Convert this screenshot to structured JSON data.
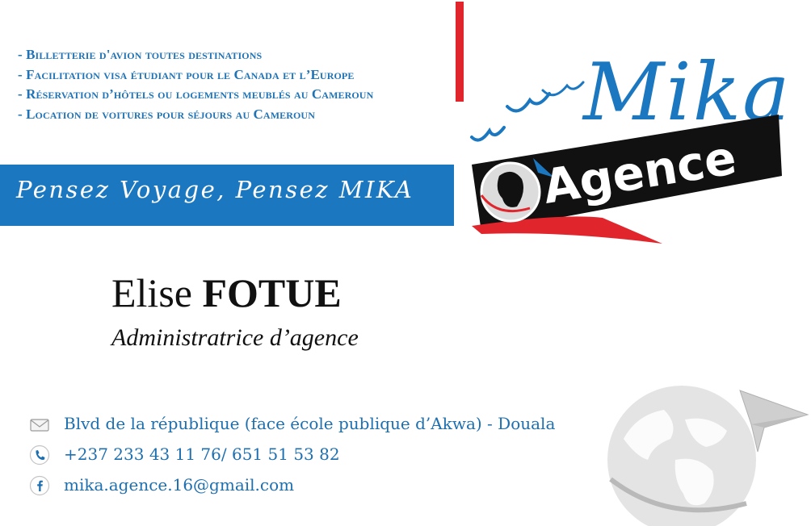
{
  "services": [
    "- Billetterie d'avion toutes destinations",
    "- Facilitation visa étudiant pour le Canada et l’Europe",
    "- Réservation d’hôtels ou logements meublés au Cameroun",
    "- Location de voitures pour séjours au Cameroun"
  ],
  "slogan": "Pensez Voyage, Pensez MIKA",
  "logo": {
    "brand": "Mika",
    "subtitle": "Agence"
  },
  "person": {
    "first_name": "Elise",
    "last_name": "FOTUE",
    "title": "Administratrice d’agence"
  },
  "contacts": [
    {
      "icon": "envelope-icon",
      "text": "Blvd de la république (face école publique d’Akwa) - Douala"
    },
    {
      "icon": "phone-icon",
      "text": "+237 233 43 11 76/ 651 51 53 82"
    },
    {
      "icon": "facebook-icon",
      "text": "mika.agence.16@gmail.com"
    }
  ],
  "colors": {
    "blue": "#1b78c0",
    "red": "#e0262c",
    "black": "#111111",
    "grey": "#c8c8c8"
  }
}
